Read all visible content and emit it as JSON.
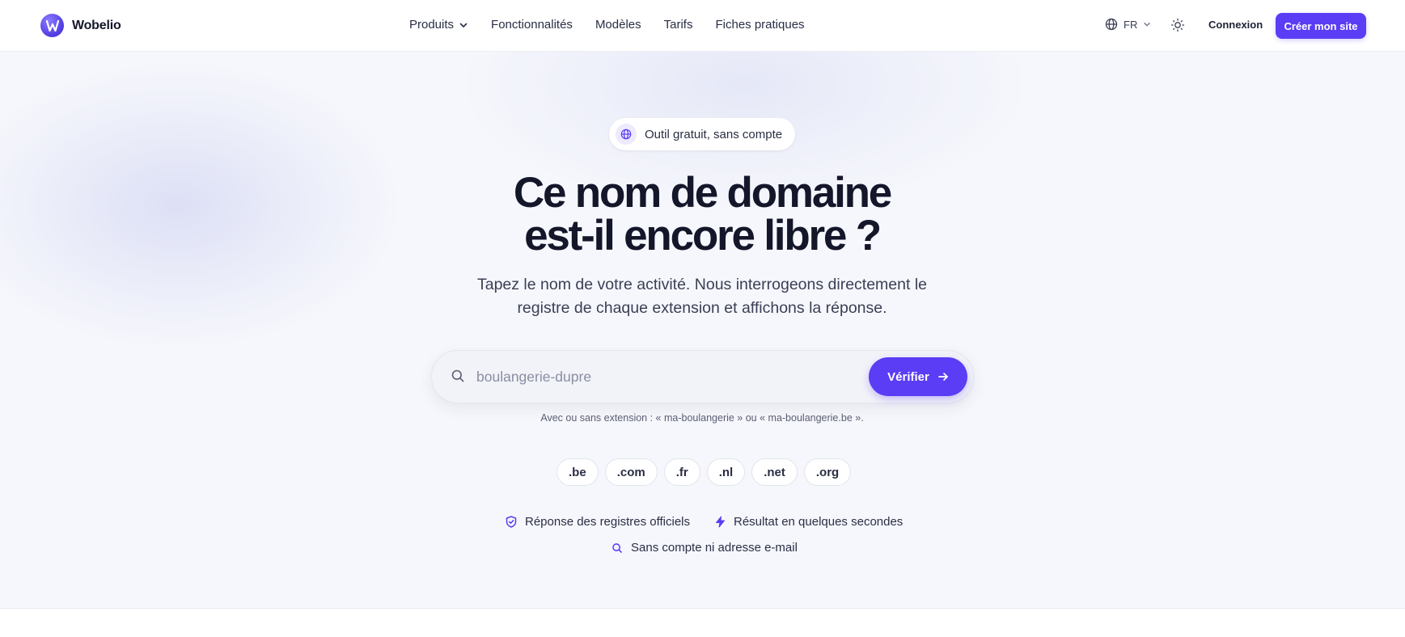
{
  "header": {
    "brand": "Wobelio",
    "nav": [
      {
        "label": "Produits",
        "has_dropdown": true
      },
      {
        "label": "Fonctionnalités"
      },
      {
        "label": "Modèles"
      },
      {
        "label": "Tarifs"
      },
      {
        "label": "Fiches pratiques"
      }
    ],
    "language": "FR",
    "login": "Connexion",
    "cta": "Créer mon site"
  },
  "hero": {
    "pill": "Outil gratuit, sans compte",
    "title_line1": "Ce nom de domaine",
    "title_line2": "est-il encore libre ?",
    "subtitle_line1": "Tapez le nom de votre activité. Nous interrogeons directement le",
    "subtitle_line2": "registre de chaque extension et affichons la réponse.",
    "search": {
      "placeholder": "boulangerie-dupre",
      "button": "Vérifier"
    },
    "hint": "Avec ou sans extension : « ma-boulangerie » ou « ma-boulangerie.be ».",
    "extensions": [
      ".be",
      ".com",
      ".fr",
      ".nl",
      ".net",
      ".org"
    ],
    "features": [
      "Réponse des registres officiels",
      "Résultat en quelques secondes",
      "Sans compte ni adresse e-mail"
    ]
  },
  "colors": {
    "accent": "#5b3df5",
    "text": "#14162a",
    "hero_bg": "#f6f7fc"
  },
  "icons": [
    "globe-icon",
    "chevron-down-icon",
    "sun-icon",
    "search-icon",
    "arrow-right-icon",
    "shield-icon",
    "bolt-icon"
  ]
}
